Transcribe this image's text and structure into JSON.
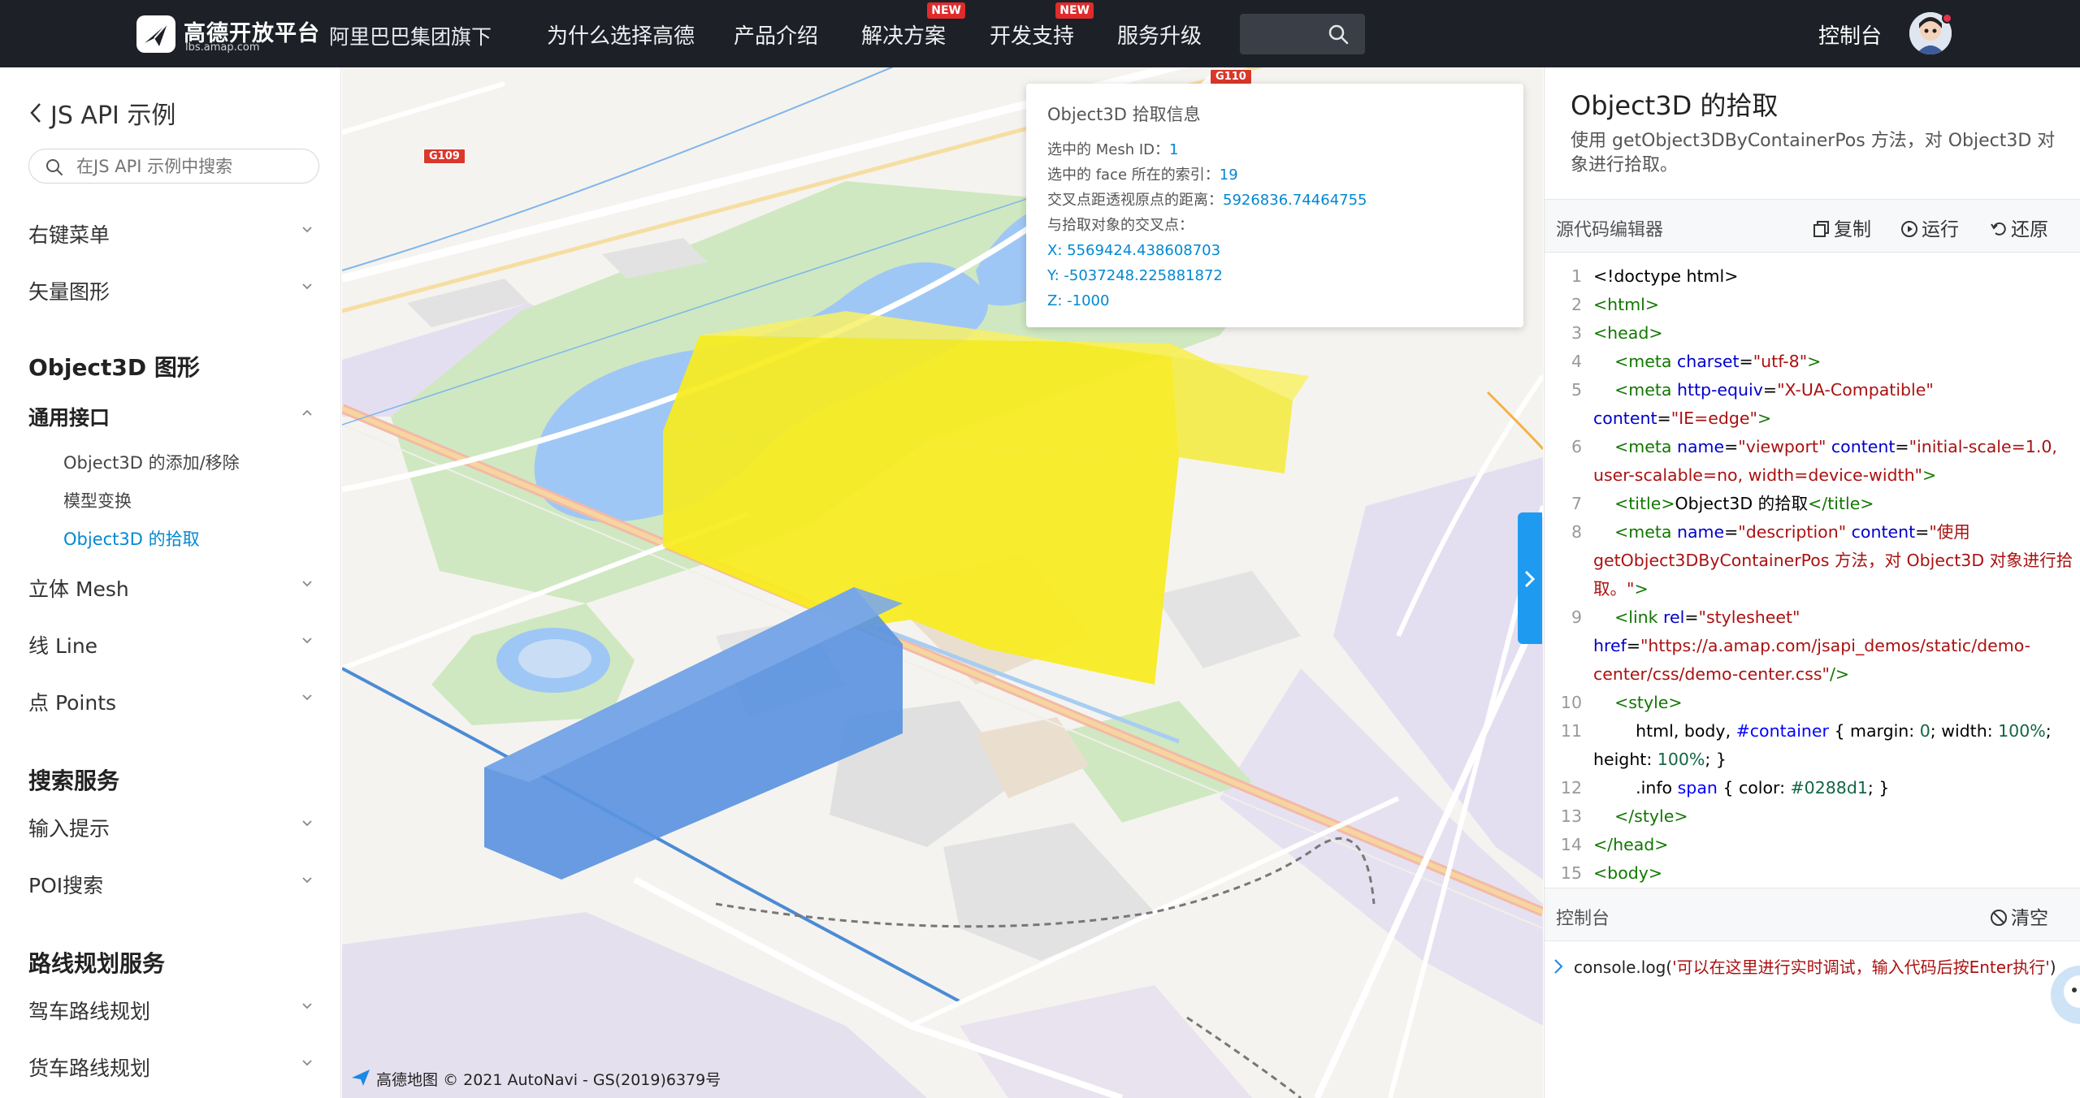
{
  "topbar": {
    "logo_name": "高德开放平台",
    "logo_domain": "lbs.amap.com",
    "subtitle": "阿里巴巴集团旗下",
    "nav": [
      {
        "label": "为什么选择高德",
        "badge": ""
      },
      {
        "label": "产品介绍",
        "badge": ""
      },
      {
        "label": "解决方案",
        "badge": "NEW"
      },
      {
        "label": "开发支持",
        "badge": "NEW"
      },
      {
        "label": "服务升级",
        "badge": ""
      }
    ],
    "console_label": "控制台"
  },
  "sidebar": {
    "back_label": "JS API 示例",
    "search_placeholder": "在JS API 示例中搜索",
    "items": [
      {
        "label": "右键菜单"
      },
      {
        "label": "矢量图形"
      }
    ],
    "section_object3d": "Object3D 图形",
    "group_general": "通用接口",
    "sub_items": [
      {
        "label": "Object3D 的添加/移除"
      },
      {
        "label": "模型变换"
      },
      {
        "label": "Object3D 的拾取"
      }
    ],
    "items2": [
      {
        "label": "立体 Mesh"
      },
      {
        "label": "线 Line"
      },
      {
        "label": "点 Points"
      }
    ],
    "section_search": "搜索服务",
    "items3": [
      {
        "label": "输入提示"
      },
      {
        "label": "POI搜索"
      }
    ],
    "section_route": "路线规划服务",
    "items4": [
      {
        "label": "驾车路线规划"
      },
      {
        "label": "货车路线规划"
      }
    ]
  },
  "map": {
    "road_labels": [
      "G110",
      "G109"
    ],
    "popup": {
      "title": "Object3D 拾取信息",
      "mesh_id_label": "选中的 Mesh ID：",
      "mesh_id": "1",
      "face_label": "选中的 face 所在的索引：",
      "face_index": "19",
      "distance_label": "交叉点距透视原点的距离：",
      "distance": "5926836.74464755",
      "intersect_label": "与拾取对象的交叉点：",
      "x": "X: 5569424.438608703",
      "y": "Y: -5037248.225881872",
      "z": "Z: -1000"
    },
    "attribution_brand": "高德地图",
    "attribution": "© 2021 AutoNavi - GS(2019)6379号",
    "colors": {
      "yellow_block": "#f7ec1d",
      "blue_block": "#5b94e0"
    }
  },
  "panel": {
    "title": "Object3D 的拾取",
    "description": "使用 getObject3DByContainerPos 方法，对 Object3D 对象进行拾取。",
    "editor_label": "源代码编辑器",
    "btn_copy": "复制",
    "btn_run": "运行",
    "btn_reset": "还原",
    "console_label": "控制台",
    "btn_clear": "清空",
    "console_cmd": "console.log(",
    "console_str": "'可以在这里进行实时调试，输入代码后按Enter执行'",
    "console_end": ")"
  },
  "code_lines": [
    {
      "n": "1",
      "parts": [
        [
          "t-text",
          "<!doctype html>"
        ]
      ]
    },
    {
      "n": "2",
      "parts": [
        [
          "t-tag",
          "<html>"
        ]
      ]
    },
    {
      "n": "3",
      "parts": [
        [
          "t-tag",
          "<head>"
        ]
      ]
    },
    {
      "n": "4",
      "parts": [
        [
          "t-text",
          "    "
        ],
        [
          "t-tag",
          "<meta "
        ],
        [
          "t-attr",
          "charset"
        ],
        [
          "t-text",
          "="
        ],
        [
          "t-str",
          "\"utf-8\""
        ],
        [
          "t-tag",
          ">"
        ]
      ]
    },
    {
      "n": "5",
      "parts": [
        [
          "t-text",
          "    "
        ],
        [
          "t-tag",
          "<meta "
        ],
        [
          "t-attr",
          "http-equiv"
        ],
        [
          "t-text",
          "="
        ],
        [
          "t-str",
          "\"X-UA-Compatible\""
        ],
        [
          "t-text",
          " "
        ],
        [
          "t-attr",
          "content"
        ],
        [
          "t-text",
          "="
        ],
        [
          "t-str",
          "\"IE=edge\""
        ],
        [
          "t-tag",
          ">"
        ]
      ]
    },
    {
      "n": "6",
      "parts": [
        [
          "t-text",
          "    "
        ],
        [
          "t-tag",
          "<meta "
        ],
        [
          "t-attr",
          "name"
        ],
        [
          "t-text",
          "="
        ],
        [
          "t-str",
          "\"viewport\""
        ],
        [
          "t-text",
          " "
        ],
        [
          "t-attr",
          "content"
        ],
        [
          "t-text",
          "="
        ],
        [
          "t-str",
          "\"initial-scale=1.0, user-scalable=no, width=device-width\""
        ],
        [
          "t-tag",
          ">"
        ]
      ]
    },
    {
      "n": "7",
      "parts": [
        [
          "t-text",
          "    "
        ],
        [
          "t-tag",
          "<title>"
        ],
        [
          "t-text",
          "Object3D 的拾取"
        ],
        [
          "t-tag",
          "</title>"
        ]
      ]
    },
    {
      "n": "8",
      "parts": [
        [
          "t-text",
          "    "
        ],
        [
          "t-tag",
          "<meta "
        ],
        [
          "t-attr",
          "name"
        ],
        [
          "t-text",
          "="
        ],
        [
          "t-str",
          "\"description\""
        ],
        [
          "t-text",
          " "
        ],
        [
          "t-attr",
          "content"
        ],
        [
          "t-text",
          "="
        ],
        [
          "t-str",
          "\"使用 getObject3DByContainerPos 方法，对 Object3D 对象进行拾取。\""
        ],
        [
          "t-tag",
          ">"
        ]
      ]
    },
    {
      "n": "9",
      "parts": [
        [
          "t-text",
          "    "
        ],
        [
          "t-tag",
          "<link "
        ],
        [
          "t-attr",
          "rel"
        ],
        [
          "t-text",
          "="
        ],
        [
          "t-str",
          "\"stylesheet\""
        ],
        [
          "t-text",
          " "
        ],
        [
          "t-attr",
          "href"
        ],
        [
          "t-text",
          "="
        ],
        [
          "t-str",
          "\"https://a.amap.com/jsapi_demos/static/demo-center/css/demo-center.css\""
        ],
        [
          "t-tag",
          "/>"
        ]
      ]
    },
    {
      "n": "10",
      "parts": [
        [
          "t-text",
          "    "
        ],
        [
          "t-tag",
          "<style>"
        ]
      ]
    },
    {
      "n": "11",
      "parts": [
        [
          "t-text",
          "        html, body, "
        ],
        [
          "t-sel",
          "#container"
        ],
        [
          "t-text",
          " { margin: "
        ],
        [
          "t-num",
          "0"
        ],
        [
          "t-text",
          "; width: "
        ],
        [
          "t-num",
          "100%"
        ],
        [
          "t-text",
          "; height: "
        ],
        [
          "t-num",
          "100%"
        ],
        [
          "t-text",
          "; }"
        ]
      ]
    },
    {
      "n": "12",
      "parts": [
        [
          "t-text",
          "        .info "
        ],
        [
          "t-sel",
          "span"
        ],
        [
          "t-text",
          " { color: "
        ],
        [
          "t-num",
          "#0288d1"
        ],
        [
          "t-text",
          "; }"
        ]
      ]
    },
    {
      "n": "13",
      "parts": [
        [
          "t-text",
          "    "
        ],
        [
          "t-tag",
          "</style>"
        ]
      ]
    },
    {
      "n": "14",
      "parts": [
        [
          "t-tag",
          "</head>"
        ]
      ]
    },
    {
      "n": "15",
      "parts": [
        [
          "t-tag",
          "<body>"
        ]
      ]
    }
  ]
}
